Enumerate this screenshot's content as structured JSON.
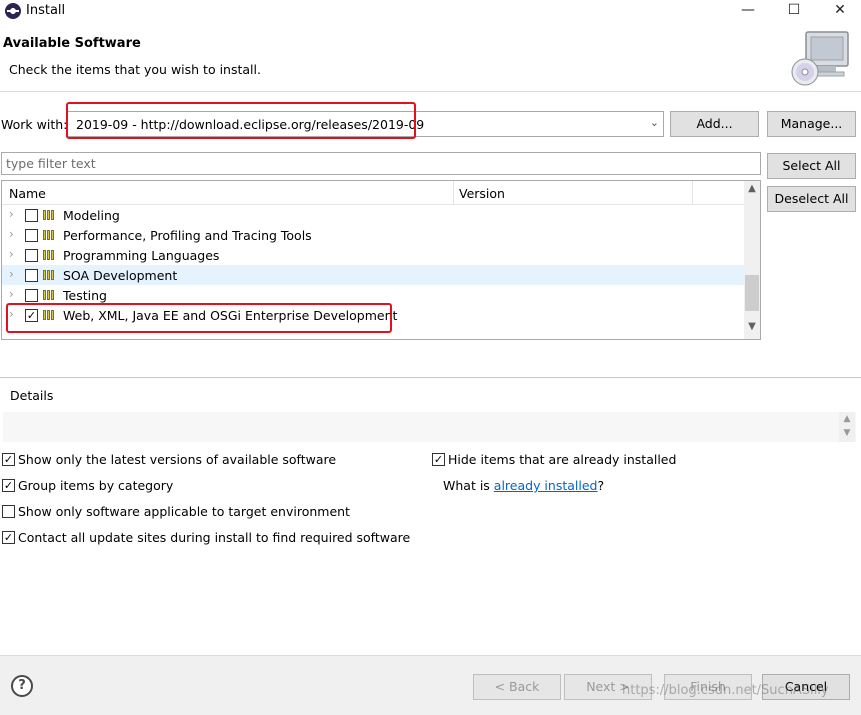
{
  "window": {
    "title": "Install",
    "minimize": "—",
    "maximize": "☐",
    "close": "✕"
  },
  "header": {
    "title": "Available Software",
    "message": "Check the items that you wish to install."
  },
  "work_with": {
    "label": "Work with:",
    "value": "2019-09 - http://download.eclipse.org/releases/2019-09",
    "add_label": "Add...",
    "manage_label": "Manage..."
  },
  "filter": {
    "placeholder": "type filter text"
  },
  "buttons": {
    "select_all": "Select All",
    "deselect_all": "Deselect All"
  },
  "tree": {
    "columns": [
      "Name",
      "Version"
    ],
    "rows": [
      {
        "label": "Modeling",
        "checked": false,
        "check_mark": ""
      },
      {
        "label": "Performance, Profiling and Tracing Tools",
        "checked": false,
        "check_mark": ""
      },
      {
        "label": "Programming Languages",
        "checked": false,
        "check_mark": ""
      },
      {
        "label": "SOA Development",
        "checked": false,
        "check_mark": ""
      },
      {
        "label": "Testing",
        "checked": false,
        "check_mark": ""
      },
      {
        "label": "Web, XML, Java EE and OSGi Enterprise Development",
        "checked": true,
        "check_mark": "✓"
      }
    ],
    "expander": "›"
  },
  "details": {
    "label": "Details"
  },
  "options": {
    "latest_versions": {
      "label": "Show only the latest versions of available software",
      "checked": true,
      "check_mark": "✓"
    },
    "group_by_category": {
      "label": "Group items by category",
      "checked": true,
      "check_mark": "✓"
    },
    "applicable_only": {
      "label": "Show only software applicable to target environment",
      "checked": false,
      "check_mark": ""
    },
    "contact_sites": {
      "label": "Contact all update sites during install to find required software",
      "checked": true,
      "check_mark": "✓"
    },
    "hide_installed": {
      "label": "Hide items that are already installed",
      "checked": true,
      "check_mark": "✓"
    },
    "what_is_prefix": "What is ",
    "what_is_link": "already installed",
    "what_is_suffix": "?"
  },
  "footer": {
    "help": "?",
    "back": "< Back",
    "next": "Next >",
    "finish": "Finish",
    "cancel": "Cancel",
    "watermark": "https://blog.csdn.net/SuchASilly"
  },
  "colors": {
    "highlight": "#e3101e",
    "link": "#0066cc",
    "hover_row": "#e5f3ff"
  }
}
